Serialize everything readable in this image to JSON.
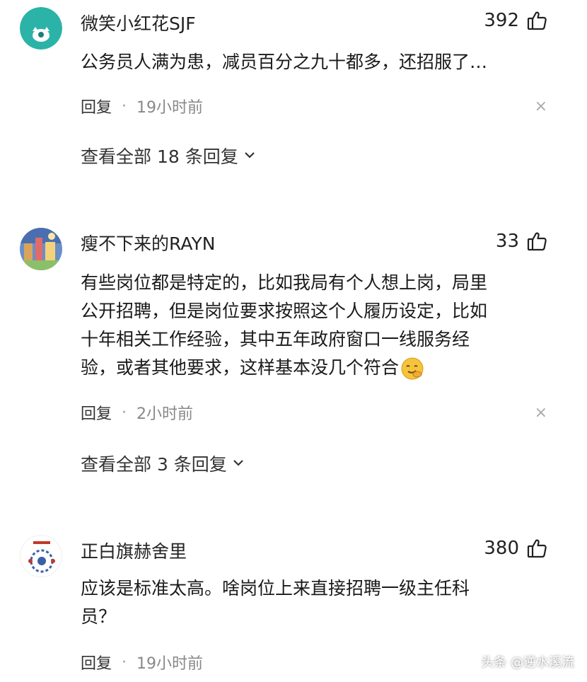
{
  "comments": [
    {
      "username": "微笑小红花SJF",
      "likes": "392",
      "lines": [
        "公务员人满为患，减员百分之九十都多，还招服了…"
      ],
      "reply_label": "回复",
      "separator": "·",
      "time": "19小时前",
      "close": "×",
      "view_replies": "查看全部 18 条回复",
      "avatar_color": "#2bb3a8"
    },
    {
      "username": "瘦不下来的RAYN",
      "likes": "33",
      "lines": [
        "有些岗位都是特定的，比如我局有个人想上岗，局里",
        "公开招聘，但是岗位要求按照这个人履历设定，比如",
        "十年相关工作经验，其中五年政府窗口一线服务经",
        "验，或者其他要求，这样基本没几个符合"
      ],
      "emoji": "smirk-emoji",
      "reply_label": "回复",
      "separator": "·",
      "time": "2小时前",
      "close": "×",
      "view_replies": "查看全部 3 条回复"
    },
    {
      "username": "正白旗赫舍里",
      "likes": "380",
      "lines": [
        "应该是标准太高。啥岗位上来直接招聘一级主任科",
        "员？"
      ],
      "reply_label": "回复",
      "separator": "·",
      "time": "19小时前"
    }
  ],
  "watermark": "头条 @逆水溪流",
  "icons": {
    "like": "thumbs-up-icon",
    "chevron": "chevron-down-icon",
    "close": "close-icon"
  }
}
